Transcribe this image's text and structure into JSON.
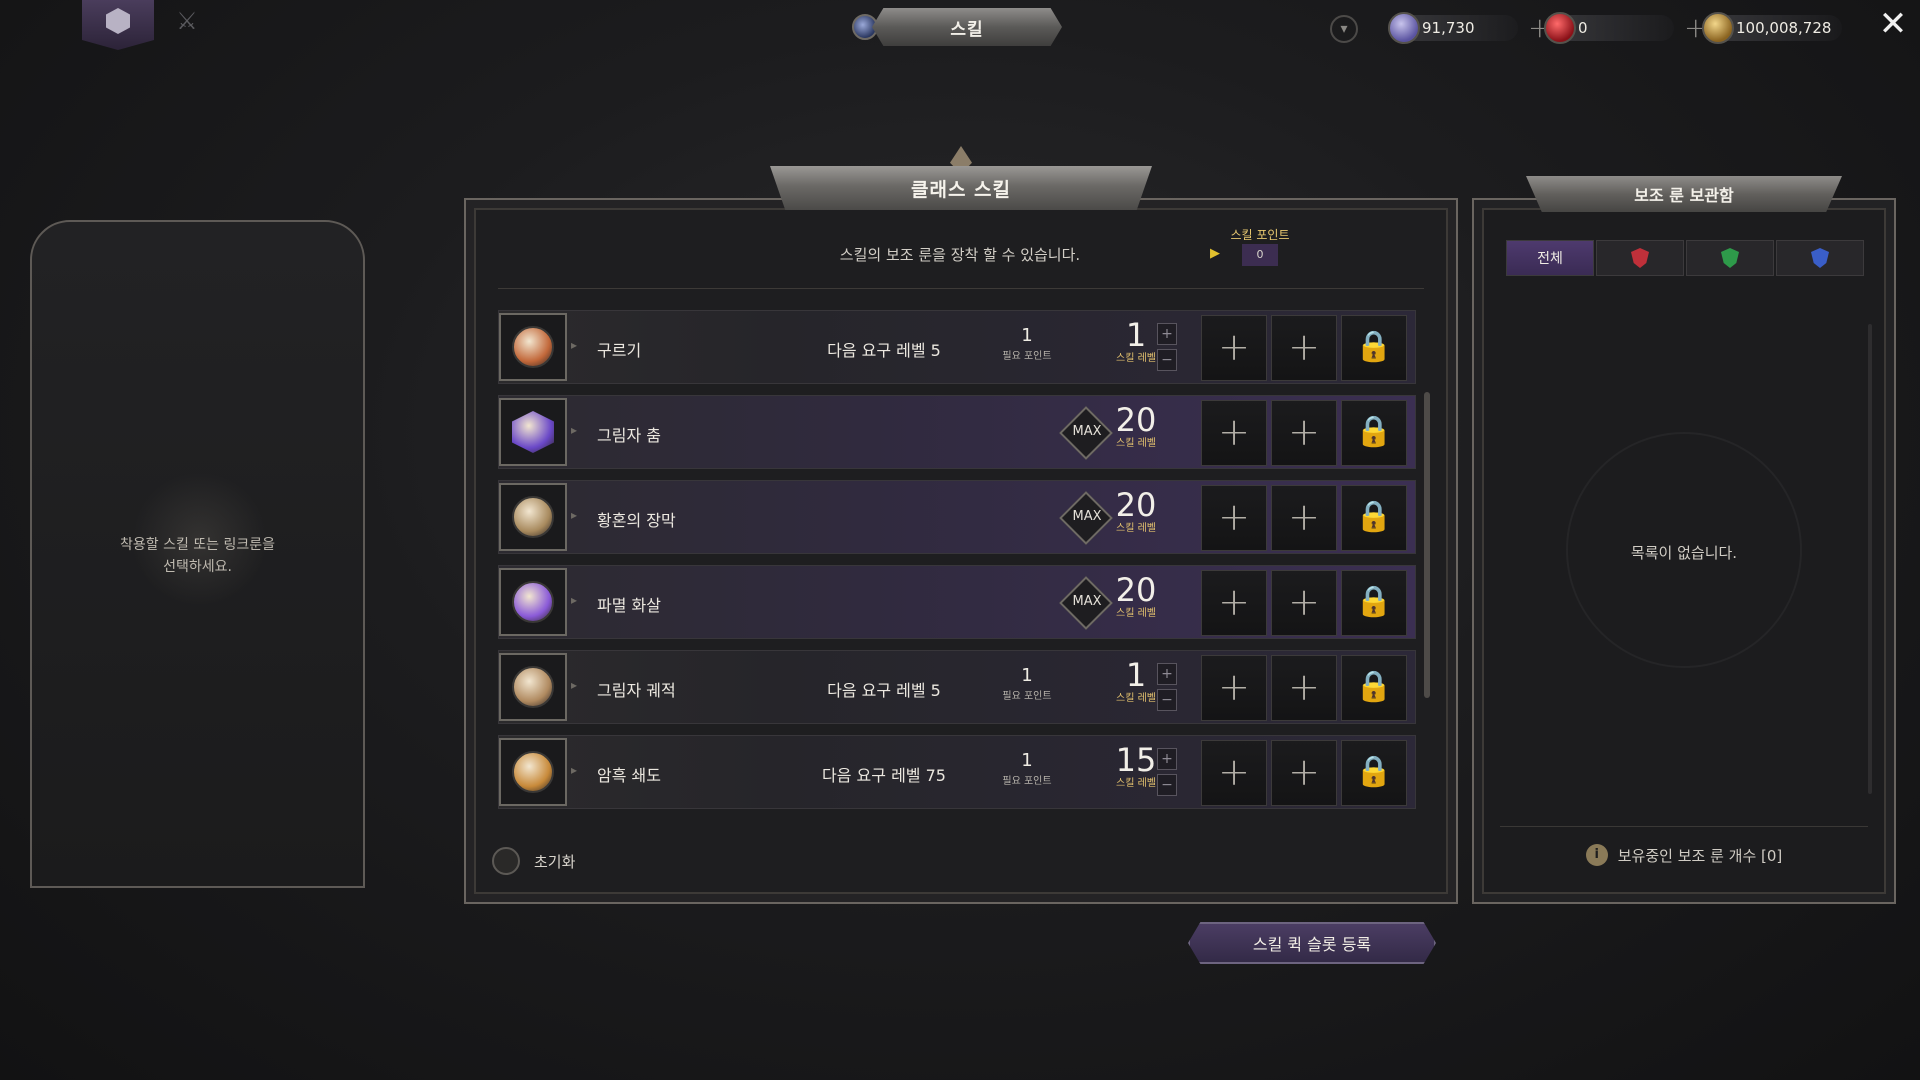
{
  "colors": {
    "accent_purple": "#3b2f52",
    "gold": "#e3c16e",
    "background": "#1c1c1e"
  },
  "topbar": {
    "title": "스킬",
    "currencies": [
      {
        "name": "crystal",
        "value": "91,730",
        "icon": "crystal-icon",
        "color": "#8a84c4"
      },
      {
        "name": "ruby",
        "value": "0",
        "icon": "ruby-icon",
        "color": "#c2262e"
      },
      {
        "name": "gold",
        "value": "100,008,728",
        "icon": "gold-coin-icon",
        "color": "#c9a24a"
      }
    ],
    "plus_glyph": "+",
    "close_glyph": "✕",
    "dropdown_glyph": "▾"
  },
  "left_panel": {
    "hint_line1": "착용할 스킬 또는 링크룬을",
    "hint_line2": "선택하세요."
  },
  "center": {
    "header": "클래스 스킬",
    "subtitle": "스킬의 보조 룬을 장착 할 수 있습니다.",
    "skill_points_label": "스킬 포인트",
    "skill_points_value": "0",
    "need_points_label": "필요 포인트",
    "skill_level_label": "스킬 레벨",
    "max_label": "MAX",
    "reset_label": "초기화",
    "skills": [
      {
        "name": "구르기",
        "requirement": "다음 요구 레벨 5",
        "need_points": "1",
        "level": "1",
        "maxed": false,
        "icon_color": "#c2683a"
      },
      {
        "name": "그림자 춤",
        "requirement": "",
        "need_points": "",
        "level": "20",
        "maxed": true,
        "icon_color": "#6a48c8"
      },
      {
        "name": "황혼의 장막",
        "requirement": "",
        "need_points": "",
        "level": "20",
        "maxed": true,
        "icon_color": "#a88a5e"
      },
      {
        "name": "파멸 화살",
        "requirement": "",
        "need_points": "",
        "level": "20",
        "maxed": true,
        "icon_color": "#8a5ad8"
      },
      {
        "name": "그림자 궤적",
        "requirement": "다음 요구 레벨 5",
        "need_points": "1",
        "level": "1",
        "maxed": false,
        "icon_color": "#b08a60"
      },
      {
        "name": "암흑 쇄도",
        "requirement": "다음 요구 레벨 75",
        "need_points": "1",
        "level": "15",
        "maxed": false,
        "icon_color": "#c88a3a"
      }
    ]
  },
  "right_panel": {
    "header": "보조 룬 보관함",
    "tabs": [
      {
        "label": "전체",
        "icon": ""
      },
      {
        "label": "",
        "icon": "red-rune-icon",
        "color": "#c0303a"
      },
      {
        "label": "",
        "icon": "green-rune-icon",
        "color": "#2e9a4a"
      },
      {
        "label": "",
        "icon": "blue-rune-icon",
        "color": "#3a5ec8"
      }
    ],
    "empty_text": "목록이 없습니다.",
    "rune_count_text": "보유중인 보조 룬 개수 [0]",
    "info_glyph": "i"
  },
  "quickslot_label": "스킬 퀵 슬롯 등록"
}
